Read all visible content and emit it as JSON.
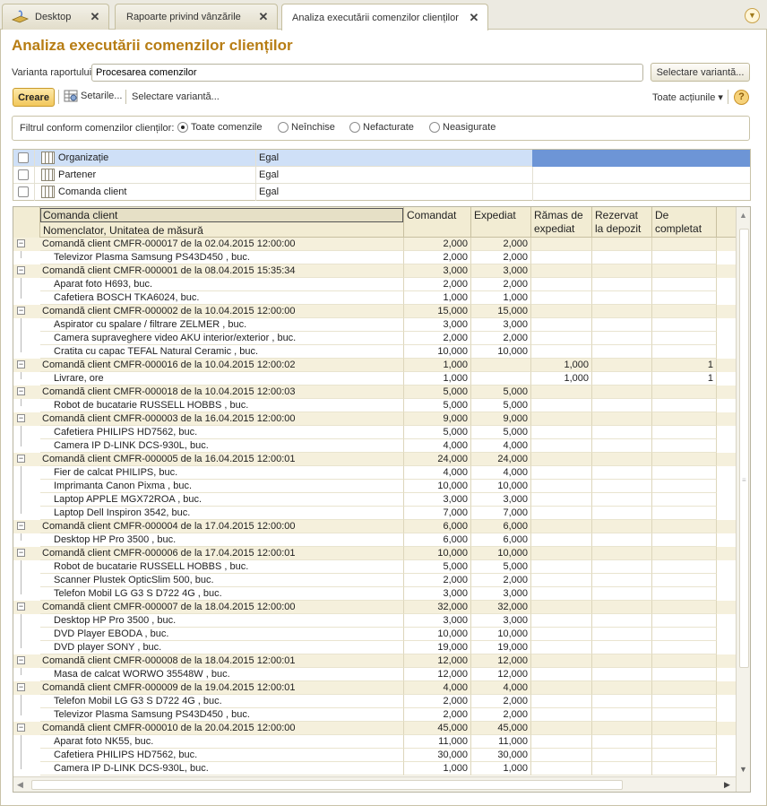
{
  "tabs": [
    {
      "label": "Desktop",
      "icon": "desktop-icon",
      "active": false
    },
    {
      "label": "Rapoarte privind vânzările",
      "active": false
    },
    {
      "label": "Analiza executării comenzilor clienților",
      "active": true
    }
  ],
  "tab_close_glyph": "✕",
  "page_title": "Analiza executării comenzilor clienților",
  "variant": {
    "label": "Varianta raportului:",
    "value": "Procesarea comenzilor",
    "select_button": "Selectare variantă..."
  },
  "toolbar": {
    "create": "Creare",
    "settings": "Setarile...",
    "select_variant": "Selectare variantă...",
    "all_actions": "Toate acțiunile ▾",
    "help": "?"
  },
  "filter": {
    "label": "Filtrul conform comenzilor clienților:",
    "options": [
      {
        "label": "Toate comenzile",
        "selected": true
      },
      {
        "label": "Neînchise",
        "selected": false
      },
      {
        "label": "Nefacturate",
        "selected": false
      },
      {
        "label": "Neasigurate",
        "selected": false
      }
    ]
  },
  "settings_rows": [
    {
      "name": "Organizație",
      "condition": "Egal",
      "selected": true
    },
    {
      "name": "Partener",
      "condition": "Egal",
      "selected": false
    },
    {
      "name": "Comanda client",
      "condition": "Egal",
      "selected": false
    }
  ],
  "report": {
    "header": {
      "group": "Comanda client",
      "item": "Nomenclator, Unitatea de măsură",
      "ordered": "Comandat",
      "shipped": "Expediat",
      "remaining": "Rămas de expediat",
      "reserved": "Rezervat la depozit",
      "tocomplete": "De completat"
    },
    "colors": {
      "group_row": "#f5f0dc",
      "header": "#f2ecd3",
      "title": "#b77d14"
    },
    "rows": [
      {
        "t": "g",
        "name": "Comandă client CMFR-000017 de la 02.04.2015 12:00:00",
        "c": "2,000",
        "e": "2,000",
        "r": "",
        "z": "",
        "d": ""
      },
      {
        "t": "i",
        "name": "Televizor Plasma Samsung PS43D450 , buc.",
        "c": "2,000",
        "e": "2,000",
        "r": "",
        "z": "",
        "d": ""
      },
      {
        "t": "g",
        "name": "Comandă client CMFR-000001 de la 08.04.2015 15:35:34",
        "c": "3,000",
        "e": "3,000",
        "r": "",
        "z": "",
        "d": ""
      },
      {
        "t": "i",
        "name": "Aparat foto H693, buc.",
        "c": "2,000",
        "e": "2,000",
        "r": "",
        "z": "",
        "d": ""
      },
      {
        "t": "i",
        "name": "Cafetiera BOSCH TKA6024, buc.",
        "c": "1,000",
        "e": "1,000",
        "r": "",
        "z": "",
        "d": ""
      },
      {
        "t": "g",
        "name": "Comandă client CMFR-000002 de la 10.04.2015 12:00:00",
        "c": "15,000",
        "e": "15,000",
        "r": "",
        "z": "",
        "d": ""
      },
      {
        "t": "i",
        "name": "Aspirator cu spalare / filtrare ZELMER , buc.",
        "c": "3,000",
        "e": "3,000",
        "r": "",
        "z": "",
        "d": ""
      },
      {
        "t": "i",
        "name": "Camera supraveghere video AKU interior/exterior , buc.",
        "c": "2,000",
        "e": "2,000",
        "r": "",
        "z": "",
        "d": ""
      },
      {
        "t": "i",
        "name": "Cratita cu capac TEFAL Natural Ceramic , buc.",
        "c": "10,000",
        "e": "10,000",
        "r": "",
        "z": "",
        "d": ""
      },
      {
        "t": "g",
        "name": "Comandă client CMFR-000016 de la 10.04.2015 12:00:02",
        "c": "1,000",
        "e": "",
        "r": "1,000",
        "z": "",
        "d": "1"
      },
      {
        "t": "i",
        "name": "Livrare, ore",
        "c": "1,000",
        "e": "",
        "r": "1,000",
        "z": "",
        "d": "1"
      },
      {
        "t": "g",
        "name": "Comandă client CMFR-000018 de la 10.04.2015 12:00:03",
        "c": "5,000",
        "e": "5,000",
        "r": "",
        "z": "",
        "d": ""
      },
      {
        "t": "i",
        "name": "Robot de bucatarie RUSSELL HOBBS , buc.",
        "c": "5,000",
        "e": "5,000",
        "r": "",
        "z": "",
        "d": ""
      },
      {
        "t": "g",
        "name": "Comandă client CMFR-000003 de la 16.04.2015 12:00:00",
        "c": "9,000",
        "e": "9,000",
        "r": "",
        "z": "",
        "d": ""
      },
      {
        "t": "i",
        "name": "Cafetiera PHILIPS HD7562, buc.",
        "c": "5,000",
        "e": "5,000",
        "r": "",
        "z": "",
        "d": ""
      },
      {
        "t": "i",
        "name": "Camera IP D-LINK DCS-930L, buc.",
        "c": "4,000",
        "e": "4,000",
        "r": "",
        "z": "",
        "d": ""
      },
      {
        "t": "g",
        "name": "Comandă client CMFR-000005 de la 16.04.2015 12:00:01",
        "c": "24,000",
        "e": "24,000",
        "r": "",
        "z": "",
        "d": ""
      },
      {
        "t": "i",
        "name": "Fier de calcat PHILIPS, buc.",
        "c": "4,000",
        "e": "4,000",
        "r": "",
        "z": "",
        "d": ""
      },
      {
        "t": "i",
        "name": "Imprimanta Canon Pixma , buc.",
        "c": "10,000",
        "e": "10,000",
        "r": "",
        "z": "",
        "d": ""
      },
      {
        "t": "i",
        "name": "Laptop APPLE  MGX72ROA , buc.",
        "c": "3,000",
        "e": "3,000",
        "r": "",
        "z": "",
        "d": ""
      },
      {
        "t": "i",
        "name": "Laptop Dell Inspiron 3542, buc.",
        "c": "7,000",
        "e": "7,000",
        "r": "",
        "z": "",
        "d": ""
      },
      {
        "t": "g",
        "name": "Comandă client CMFR-000004 de la 17.04.2015 12:00:00",
        "c": "6,000",
        "e": "6,000",
        "r": "",
        "z": "",
        "d": ""
      },
      {
        "t": "i",
        "name": "Desktop HP Pro 3500 , buc.",
        "c": "6,000",
        "e": "6,000",
        "r": "",
        "z": "",
        "d": ""
      },
      {
        "t": "g",
        "name": "Comandă client CMFR-000006 de la 17.04.2015 12:00:01",
        "c": "10,000",
        "e": "10,000",
        "r": "",
        "z": "",
        "d": ""
      },
      {
        "t": "i",
        "name": "Robot de bucatarie RUSSELL HOBBS , buc.",
        "c": "5,000",
        "e": "5,000",
        "r": "",
        "z": "",
        "d": ""
      },
      {
        "t": "i",
        "name": "Scanner Plustek OpticSlim 500, buc.",
        "c": "2,000",
        "e": "2,000",
        "r": "",
        "z": "",
        "d": ""
      },
      {
        "t": "i",
        "name": "Telefon Mobil LG G3 S D722 4G , buc.",
        "c": "3,000",
        "e": "3,000",
        "r": "",
        "z": "",
        "d": ""
      },
      {
        "t": "g",
        "name": "Comandă client CMFR-000007 de la 18.04.2015 12:00:00",
        "c": "32,000",
        "e": "32,000",
        "r": "",
        "z": "",
        "d": ""
      },
      {
        "t": "i",
        "name": "Desktop HP Pro 3500 , buc.",
        "c": "3,000",
        "e": "3,000",
        "r": "",
        "z": "",
        "d": ""
      },
      {
        "t": "i",
        "name": "DVD Player EBODA , buc.",
        "c": "10,000",
        "e": "10,000",
        "r": "",
        "z": "",
        "d": ""
      },
      {
        "t": "i",
        "name": "DVD player SONY , buc.",
        "c": "19,000",
        "e": "19,000",
        "r": "",
        "z": "",
        "d": ""
      },
      {
        "t": "g",
        "name": "Comandă client CMFR-000008 de la 18.04.2015 12:00:01",
        "c": "12,000",
        "e": "12,000",
        "r": "",
        "z": "",
        "d": ""
      },
      {
        "t": "i",
        "name": "Masa de calcat WORWO 35548W , buc.",
        "c": "12,000",
        "e": "12,000",
        "r": "",
        "z": "",
        "d": ""
      },
      {
        "t": "g",
        "name": "Comandă client CMFR-000009 de la 19.04.2015 12:00:01",
        "c": "4,000",
        "e": "4,000",
        "r": "",
        "z": "",
        "d": ""
      },
      {
        "t": "i",
        "name": "Telefon Mobil LG G3 S D722 4G , buc.",
        "c": "2,000",
        "e": "2,000",
        "r": "",
        "z": "",
        "d": ""
      },
      {
        "t": "i",
        "name": "Televizor Plasma Samsung PS43D450 , buc.",
        "c": "2,000",
        "e": "2,000",
        "r": "",
        "z": "",
        "d": ""
      },
      {
        "t": "g",
        "name": "Comandă client CMFR-000010 de la 20.04.2015 12:00:00",
        "c": "45,000",
        "e": "45,000",
        "r": "",
        "z": "",
        "d": ""
      },
      {
        "t": "i",
        "name": "Aparat foto NK55, buc.",
        "c": "11,000",
        "e": "11,000",
        "r": "",
        "z": "",
        "d": ""
      },
      {
        "t": "i",
        "name": "Cafetiera PHILIPS HD7562, buc.",
        "c": "30,000",
        "e": "30,000",
        "r": "",
        "z": "",
        "d": ""
      },
      {
        "t": "i",
        "name": "Camera IP D-LINK DCS-930L, buc.",
        "c": "1,000",
        "e": "1,000",
        "r": "",
        "z": "",
        "d": ""
      }
    ]
  }
}
